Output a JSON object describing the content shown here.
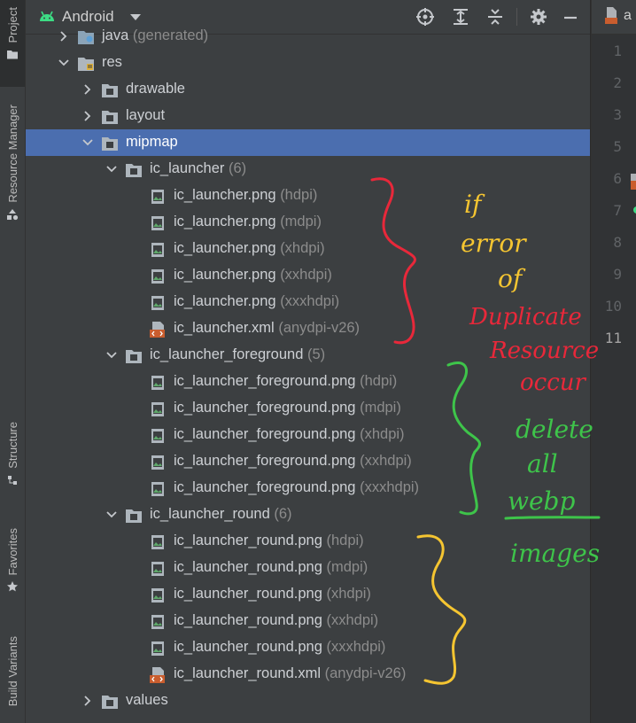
{
  "stripe": {
    "project_label": "Project",
    "resource_manager_label": "Resource Manager",
    "structure_label": "Structure",
    "favorites_label": "Favorites",
    "build_variants_label": "Build Variants"
  },
  "toolbar": {
    "view_name": "Android",
    "icons": [
      "crosshair-icon",
      "expand-all-icon",
      "collapse-all-icon",
      "gear-icon",
      "minimize-icon"
    ]
  },
  "editor": {
    "tab_partial": "a",
    "line_numbers": [
      "1",
      "2",
      "3",
      "5",
      "6",
      "7",
      "8",
      "9",
      "10",
      "11"
    ]
  },
  "tree": [
    {
      "indent": 1,
      "arrow": "right",
      "icon": "folder-gen",
      "name": "java",
      "hint": "(generated)"
    },
    {
      "indent": 1,
      "arrow": "down",
      "icon": "folder-res",
      "name": "res",
      "hint": ""
    },
    {
      "indent": 2,
      "arrow": "right",
      "icon": "folder",
      "name": "drawable",
      "hint": ""
    },
    {
      "indent": 2,
      "arrow": "right",
      "icon": "folder",
      "name": "layout",
      "hint": ""
    },
    {
      "indent": 2,
      "arrow": "down",
      "icon": "folder",
      "name": "mipmap",
      "hint": "",
      "selected": true
    },
    {
      "indent": 3,
      "arrow": "down",
      "icon": "folder",
      "name": "ic_launcher",
      "hint": "(6)"
    },
    {
      "indent": 4,
      "arrow": "",
      "icon": "png",
      "name": "ic_launcher.png",
      "hint": "(hdpi)"
    },
    {
      "indent": 4,
      "arrow": "",
      "icon": "png",
      "name": "ic_launcher.png",
      "hint": "(mdpi)"
    },
    {
      "indent": 4,
      "arrow": "",
      "icon": "png",
      "name": "ic_launcher.png",
      "hint": "(xhdpi)"
    },
    {
      "indent": 4,
      "arrow": "",
      "icon": "png",
      "name": "ic_launcher.png",
      "hint": "(xxhdpi)"
    },
    {
      "indent": 4,
      "arrow": "",
      "icon": "png",
      "name": "ic_launcher.png",
      "hint": "(xxxhdpi)"
    },
    {
      "indent": 4,
      "arrow": "",
      "icon": "xml",
      "name": "ic_launcher.xml",
      "hint": "(anydpi-v26)"
    },
    {
      "indent": 3,
      "arrow": "down",
      "icon": "folder",
      "name": "ic_launcher_foreground",
      "hint": "(5)"
    },
    {
      "indent": 4,
      "arrow": "",
      "icon": "png",
      "name": "ic_launcher_foreground.png",
      "hint": "(hdpi)"
    },
    {
      "indent": 4,
      "arrow": "",
      "icon": "png",
      "name": "ic_launcher_foreground.png",
      "hint": "(mdpi)"
    },
    {
      "indent": 4,
      "arrow": "",
      "icon": "png",
      "name": "ic_launcher_foreground.png",
      "hint": "(xhdpi)"
    },
    {
      "indent": 4,
      "arrow": "",
      "icon": "png",
      "name": "ic_launcher_foreground.png",
      "hint": "(xxhdpi)"
    },
    {
      "indent": 4,
      "arrow": "",
      "icon": "png",
      "name": "ic_launcher_foreground.png",
      "hint": "(xxxhdpi)"
    },
    {
      "indent": 3,
      "arrow": "down",
      "icon": "folder",
      "name": "ic_launcher_round",
      "hint": "(6)"
    },
    {
      "indent": 4,
      "arrow": "",
      "icon": "png",
      "name": "ic_launcher_round.png",
      "hint": "(hdpi)"
    },
    {
      "indent": 4,
      "arrow": "",
      "icon": "png",
      "name": "ic_launcher_round.png",
      "hint": "(mdpi)"
    },
    {
      "indent": 4,
      "arrow": "",
      "icon": "png",
      "name": "ic_launcher_round.png",
      "hint": "(xhdpi)"
    },
    {
      "indent": 4,
      "arrow": "",
      "icon": "png",
      "name": "ic_launcher_round.png",
      "hint": "(xxhdpi)"
    },
    {
      "indent": 4,
      "arrow": "",
      "icon": "png",
      "name": "ic_launcher_round.png",
      "hint": "(xxxhdpi)"
    },
    {
      "indent": 4,
      "arrow": "",
      "icon": "xml",
      "name": "ic_launcher_round.xml",
      "hint": "(anydpi-v26)"
    },
    {
      "indent": 2,
      "arrow": "right",
      "icon": "folder",
      "name": "values",
      "hint": ""
    }
  ],
  "annotations": {
    "if_line": "if",
    "error_line": "error",
    "of_line": "of",
    "duplicate_line": "Duplicate",
    "resource_line": "Resource",
    "occur_line": "occur",
    "delete_line": "delete",
    "all_line": "all",
    "webp_line": "webp",
    "images_line": "images",
    "colors": {
      "yellow": "#f5c531",
      "red": "#e8283a",
      "green": "#3ec44a"
    }
  },
  "colors": {
    "panel_bg": "#3c3f41",
    "selection": "#4b6eaf",
    "android_green": "#3ddc84",
    "text": "#cdd0d4",
    "hint": "#8c8c8c"
  }
}
